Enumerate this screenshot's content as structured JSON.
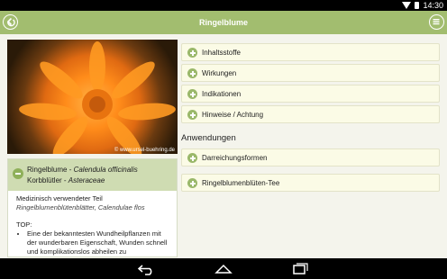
{
  "status_bar": {
    "time": "14:30",
    "icons": [
      "wifi-icon",
      "battery-icon"
    ]
  },
  "app_bar": {
    "title": "Ringelblume",
    "left_icon": "back-icon",
    "right_icon": "menu-icon",
    "color": "#a2bd6f"
  },
  "photo": {
    "credit": "© www.ursel-buehring.de"
  },
  "info_card": {
    "name": "Ringelblume",
    "separator": " - ",
    "latin_name": "Calendula officinalis",
    "family": "Korbblütler",
    "family_latin": "Asteraceae",
    "used_part_heading": "Medizinisch verwendeter Teil",
    "used_part": "Ringelblumenblütenblätter, Calendulae flos",
    "top_label": "TOP:",
    "top_bullet": "Eine der bekanntesten Wundheilpflanzen mit der wunderbaren Eigenschaft, Wunden schnell und komplikationslos abheilen zu"
  },
  "sections": [
    {
      "label": "Inhaltsstoffe"
    },
    {
      "label": "Wirkungen"
    },
    {
      "label": "Indikationen"
    },
    {
      "label": "Hinweise / Achtung"
    }
  ],
  "applications": {
    "title": "Anwendungen",
    "items": [
      {
        "label": "Darreichungsformen"
      },
      {
        "label": "Ringelblumenblüten-Tee"
      }
    ]
  },
  "nav_bar": {
    "icons": [
      "back-nav-icon",
      "home-nav-icon",
      "recents-nav-icon"
    ]
  }
}
